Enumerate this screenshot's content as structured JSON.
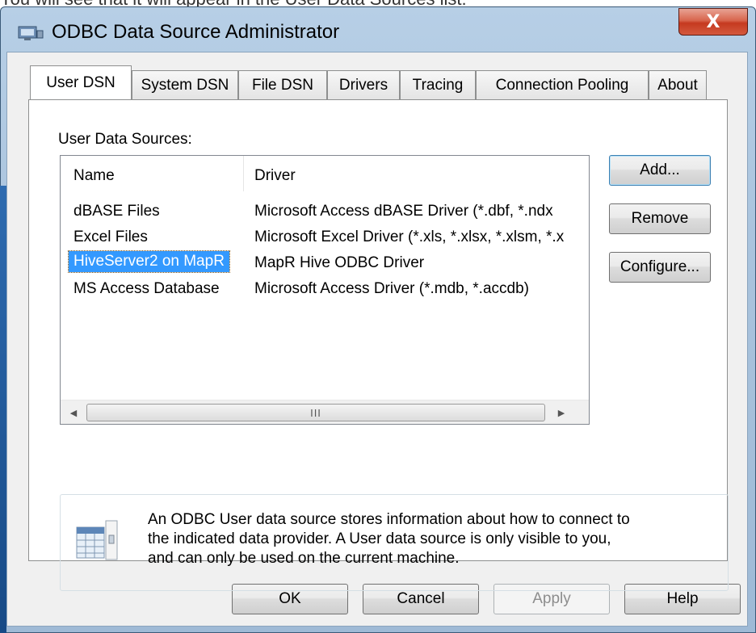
{
  "top_strip_text": "You will see that it will appear in the User Data Sources list:",
  "window": {
    "title": "ODBC Data Source Administrator",
    "close_glyph": "X"
  },
  "tabs": [
    {
      "label": "User DSN",
      "active": true
    },
    {
      "label": "System DSN",
      "active": false
    },
    {
      "label": "File DSN",
      "active": false
    },
    {
      "label": "Drivers",
      "active": false
    },
    {
      "label": "Tracing",
      "active": false
    },
    {
      "label": "Connection Pooling",
      "active": false
    },
    {
      "label": "About",
      "active": false
    }
  ],
  "user_dsn": {
    "list_label": "User Data Sources:",
    "columns": {
      "name": "Name",
      "driver": "Driver"
    },
    "rows": [
      {
        "name": "dBASE Files",
        "driver": "Microsoft Access dBASE Driver (*.dbf, *.ndx"
      },
      {
        "name": "Excel Files",
        "driver": "Microsoft Excel Driver (*.xls, *.xlsx, *.xlsm, *.x"
      },
      {
        "name": "HiveServer2 on MapR",
        "driver": "MapR Hive ODBC Driver",
        "selected": true
      },
      {
        "name": "MS Access Database",
        "driver": "Microsoft Access Driver (*.mdb, *.accdb)"
      }
    ],
    "scrollbar_grip": "III",
    "buttons": {
      "add": "Add...",
      "remove": "Remove",
      "configure": "Configure..."
    },
    "info": {
      "icon": "data-source-icon",
      "lines": [
        "An ODBC User data source stores information about how to connect to",
        "the indicated data provider.  A User data source is only visible to you,",
        "and can only be used on the current machine."
      ]
    }
  },
  "footer_buttons": {
    "ok": "OK",
    "cancel": "Cancel",
    "apply": "Apply",
    "help": "Help"
  },
  "colors": {
    "selection": "#3399ff",
    "close_button": "#c5391f",
    "title_bar": "#a9c3dd"
  }
}
